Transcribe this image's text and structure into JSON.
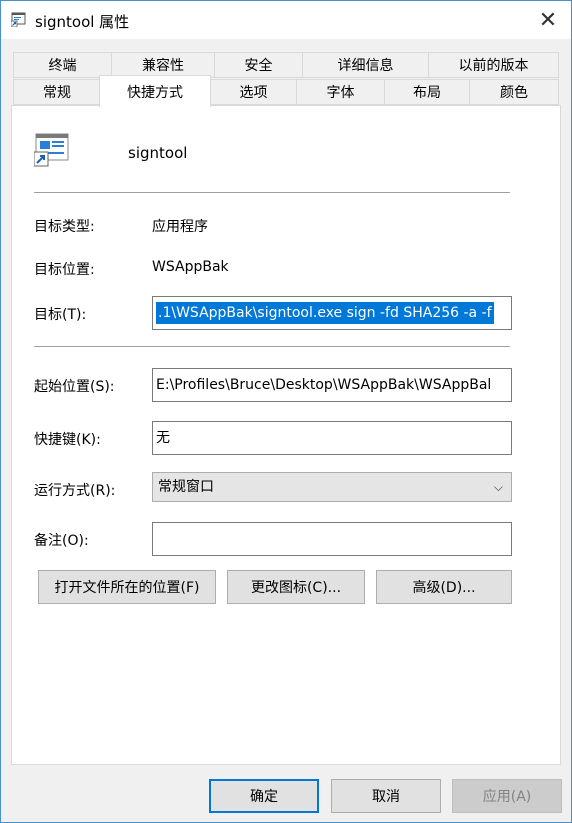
{
  "window": {
    "title": "signtool 属性"
  },
  "tabs": {
    "row1": [
      "终端",
      "兼容性",
      "安全",
      "详细信息",
      "以前的版本"
    ],
    "row2": [
      "常规",
      "快捷方式",
      "选项",
      "字体",
      "布局",
      "颜色"
    ],
    "active": "快捷方式"
  },
  "shortcut": {
    "name": "signtool",
    "target_type_label": "目标类型:",
    "target_type_value": "应用程序",
    "target_location_label": "目标位置:",
    "target_location_value": "WSAppBak",
    "target_label": "目标(T):",
    "target_value": ".1\\WSAppBak\\signtool.exe sign -fd SHA256 -a -f",
    "start_in_label": "起始位置(S):",
    "start_in_value": "E:\\Profiles\\Bruce\\Desktop\\WSAppBak\\WSAppBal",
    "hotkey_label": "快捷键(K):",
    "hotkey_value": "无",
    "run_label": "运行方式(R):",
    "run_value": "常规窗口",
    "comment_label": "备注(O):",
    "comment_value": ""
  },
  "buttons": {
    "open_location": "打开文件所在的位置(F)",
    "change_icon": "更改图标(C)...",
    "advanced": "高级(D)...",
    "ok": "确定",
    "cancel": "取消",
    "apply": "应用(A)"
  },
  "colors": {
    "accent": "#0078d7",
    "border": "#4a90c8"
  }
}
